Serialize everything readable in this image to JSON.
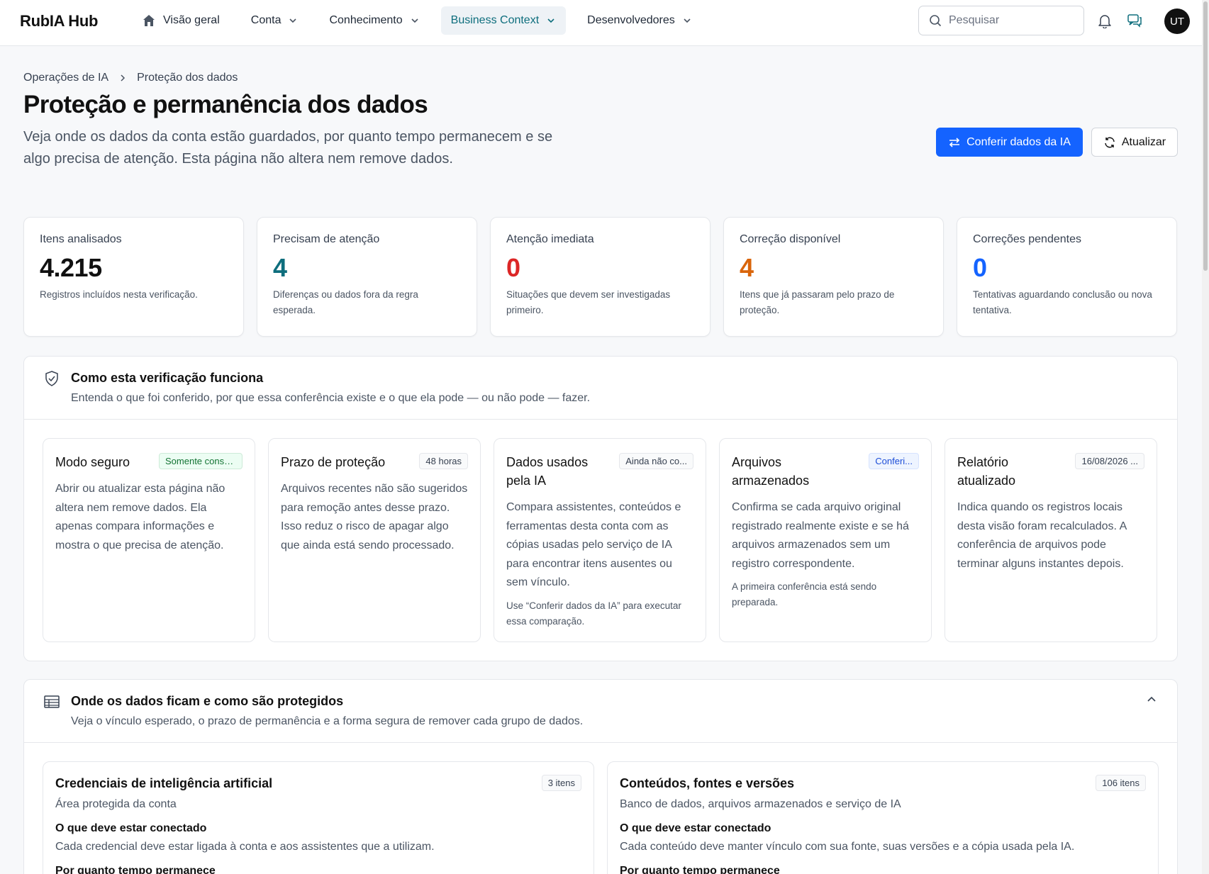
{
  "brand": "RubIA Hub",
  "nav": {
    "items": [
      {
        "label": "Visão geral"
      },
      {
        "label": "Conta"
      },
      {
        "label": "Conhecimento"
      },
      {
        "label": "Business Context"
      },
      {
        "label": "Desenvolvedores"
      }
    ],
    "active": "Business Context"
  },
  "search": {
    "placeholder": "Pesquisar"
  },
  "user": {
    "initials": "UT"
  },
  "breadcrumb": {
    "parent": "Operações de IA",
    "current": "Proteção dos dados"
  },
  "header": {
    "title": "Proteção e permanência dos dados",
    "description": "Veja onde os dados da conta estão guardados, por quanto tempo permanecem e se algo precisa de atenção. Esta página não altera nem remove dados.",
    "primary_button": "Conferir dados da IA",
    "secondary_button": "Atualizar"
  },
  "stats": [
    {
      "label": "Itens analisados",
      "value": "4.215",
      "desc": "Registros incluídos nesta verificação.",
      "color": "#111111"
    },
    {
      "label": "Precisam de atenção",
      "value": "4",
      "desc": "Diferenças ou dados fora da regra esperada.",
      "color": "#0e6e7d"
    },
    {
      "label": "Atenção imediata",
      "value": "0",
      "desc": "Situações que devem ser investigadas primeiro.",
      "color": "#dc2626"
    },
    {
      "label": "Correção disponível",
      "value": "4",
      "desc": "Itens que já passaram pelo prazo de proteção.",
      "color": "#d9650b"
    },
    {
      "label": "Correções pendentes",
      "value": "0",
      "desc": "Tentativas aguardando conclusão ou nova tentativa.",
      "color": "#1463ff"
    }
  ],
  "how": {
    "title": "Como esta verificação funciona",
    "subtitle": "Entenda o que foi conferido, por que essa conferência existe e o que ela pode — ou não pode — fazer.",
    "cards": [
      {
        "title": "Modo seguro",
        "badge": "Somente consulta",
        "body": "Abrir ou atualizar esta página não altera nem remove dados. Ela apenas compara informações e mostra o que precisa de atenção.",
        "note": ""
      },
      {
        "title": "Prazo de proteção",
        "badge": "48 horas",
        "body": "Arquivos recentes não são sugeridos para remoção antes desse prazo. Isso reduz o risco de apagar algo que ainda está sendo processado.",
        "note": ""
      },
      {
        "title": "Dados usados pela IA",
        "badge": "Ainda não co...",
        "body": "Compara assistentes, conteúdos e ferramentas desta conta com as cópias usadas pelo serviço de IA para encontrar itens ausentes ou sem vínculo.",
        "note": "Use “Conferir dados da IA” para executar essa comparação."
      },
      {
        "title": "Arquivos armazenados",
        "badge": "Conferi...",
        "body": "Confirma se cada arquivo original registrado realmente existe e se há arquivos armazenados sem um registro correspondente.",
        "note": "A primeira conferência está sendo preparada."
      },
      {
        "title": "Relatório atualizado",
        "badge": "16/08/2026 ...",
        "body": "Indica quando os registros locais desta visão foram recalculados. A conferência de arquivos pode terminar alguns instantes depois.",
        "note": ""
      }
    ]
  },
  "where": {
    "title": "Onde os dados ficam e como são protegidos",
    "subtitle": "Veja o vínculo esperado, o prazo de permanência e a forma segura de remover cada grupo de dados.",
    "cards": [
      {
        "title": "Credenciais de inteligência artificial",
        "badge": "3 itens",
        "sub": "Área protegida da conta",
        "label": "O que deve estar conectado",
        "text": "Cada credencial deve estar ligada à conta e aos assistentes que a utilizam.",
        "label2": "Por quanto tempo permanece"
      },
      {
        "title": "Conteúdos, fontes e versões",
        "badge": "106 itens",
        "sub": "Banco de dados, arquivos armazenados e serviço de IA",
        "label": "O que deve estar conectado",
        "text": "Cada conteúdo deve manter vínculo com sua fonte, suas versões e a cópia usada pela IA.",
        "label2": "Por quanto tempo permanece"
      }
    ]
  }
}
